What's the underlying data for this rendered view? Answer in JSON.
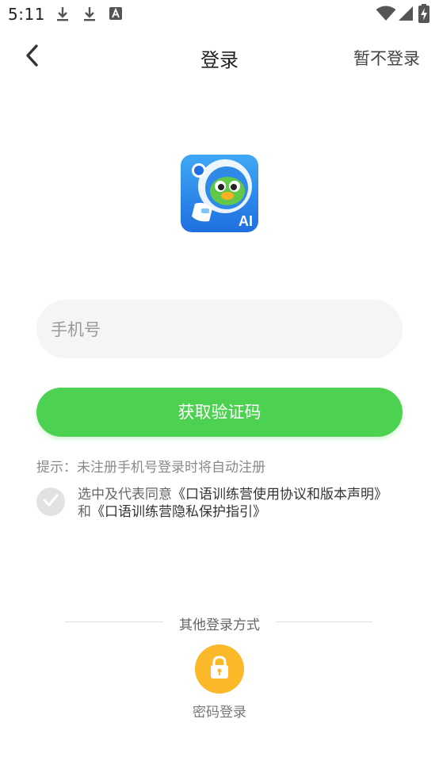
{
  "status_bar": {
    "time": "5:11",
    "icons": [
      "download-icon",
      "download-icon",
      "font-icon",
      "wifi-icon",
      "signal-icon",
      "battery-charging-icon"
    ]
  },
  "nav": {
    "title": "登录",
    "skip_label": "暂不登录",
    "back_icon": "back-chevron-icon"
  },
  "logo": {
    "badge_text": "AI"
  },
  "login_form": {
    "phone_placeholder": "手机号",
    "phone_value": "",
    "get_code_label": "获取验证码",
    "hint": "提示：未注册手机号登录时将自动注册",
    "agreement": {
      "prefix": "选中及代表同意",
      "user_agreement": "《口语训练营使用协议和版本声明》",
      "joiner": "和",
      "privacy_policy": "《口语训练营隐私保护指引》",
      "checked": false
    }
  },
  "other_login": {
    "title": "其他登录方式",
    "password_login_label": "密码登录",
    "password_icon": "lock-icon"
  },
  "colors": {
    "primary_green": "#4cd150",
    "input_bg": "#f5f5f5",
    "lock_button": "#fbb829",
    "check_grey": "#e2e2e2"
  }
}
